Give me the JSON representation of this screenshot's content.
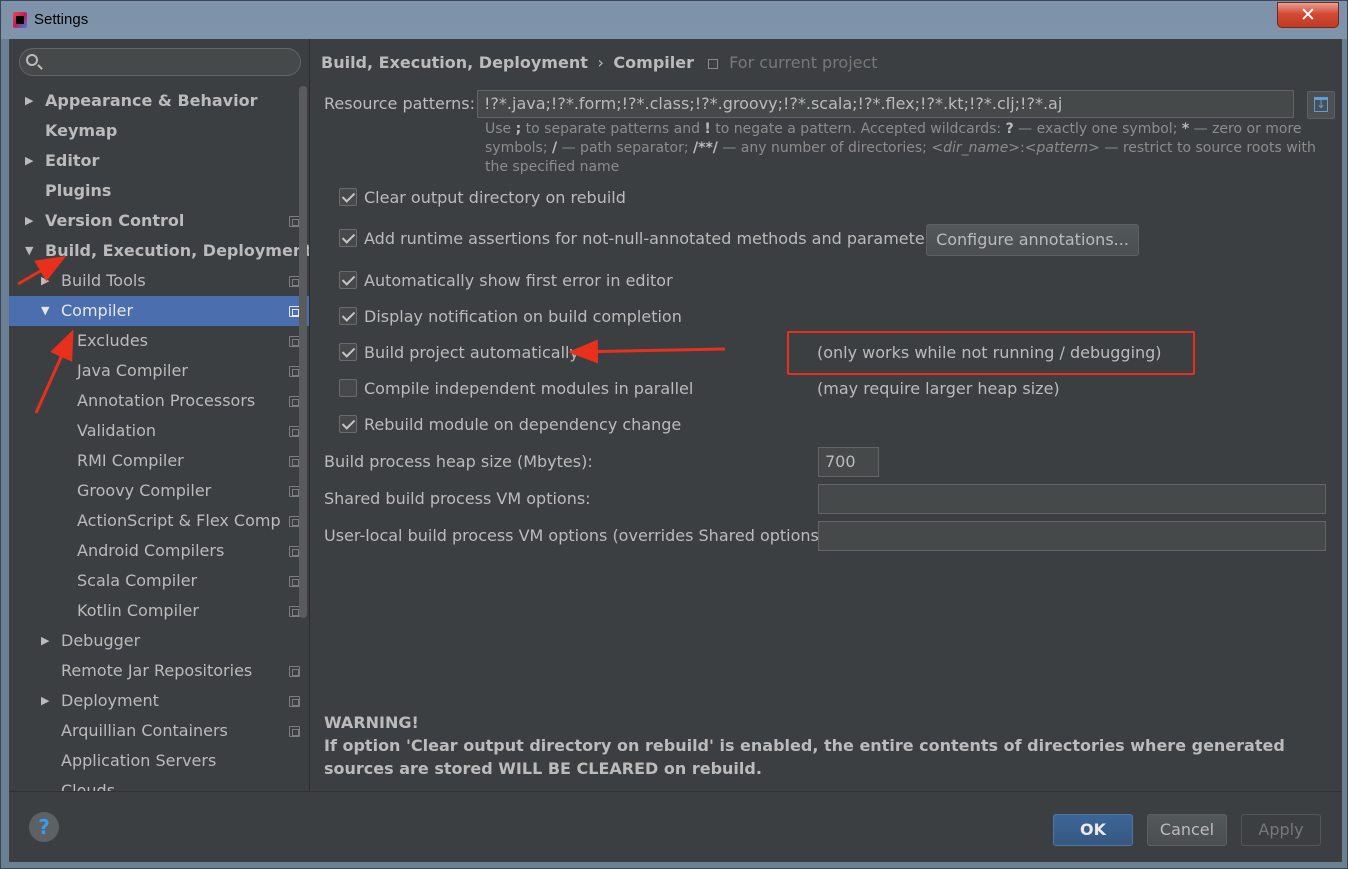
{
  "window": {
    "title": "Settings",
    "close_symbol": "✕"
  },
  "search": {
    "placeholder": ""
  },
  "sidebar": {
    "items": [
      {
        "label": "Appearance & Behavior",
        "arrow": "▶"
      },
      {
        "label": "Keymap"
      },
      {
        "label": "Editor",
        "arrow": "▶"
      },
      {
        "label": "Plugins"
      },
      {
        "label": "Version Control",
        "arrow": "▶"
      },
      {
        "label": "Build, Execution, Deployment",
        "arrow": "▼"
      },
      {
        "label": "Build Tools",
        "arrow": "▶"
      },
      {
        "label": "Compiler",
        "arrow": "▼"
      },
      {
        "label": "Excludes"
      },
      {
        "label": "Java Compiler"
      },
      {
        "label": "Annotation Processors"
      },
      {
        "label": "Validation"
      },
      {
        "label": "RMI Compiler"
      },
      {
        "label": "Groovy Compiler"
      },
      {
        "label": "ActionScript & Flex Comp"
      },
      {
        "label": "Android Compilers"
      },
      {
        "label": "Scala Compiler"
      },
      {
        "label": "Kotlin Compiler"
      },
      {
        "label": "Debugger",
        "arrow": "▶"
      },
      {
        "label": "Remote Jar Repositories"
      },
      {
        "label": "Deployment",
        "arrow": "▶"
      },
      {
        "label": "Arquillian Containers"
      },
      {
        "label": "Application Servers"
      },
      {
        "label": "Clouds"
      }
    ]
  },
  "breadcrumb": {
    "part1": "Build, Execution, Deployment",
    "separator": "›",
    "part2": "Compiler",
    "scope": "For current project"
  },
  "resource_patterns": {
    "label": "Resource patterns:",
    "value": "!?*.java;!?*.form;!?*.class;!?*.groovy;!?*.scala;!?*.flex;!?*.kt;!?*.clj;!?*.aj"
  },
  "hint": {
    "t1": "Use ",
    "b1": ";",
    "t2": " to separate patterns and ",
    "b2": "!",
    "t3": " to negate a pattern. Accepted wildcards: ",
    "b3": "?",
    "t4": " — exactly one symbol; ",
    "b4": "*",
    "t5": " — zero or more symbols; ",
    "b5": "/",
    "t6": " — path separator; ",
    "b6": "/**/",
    "t7": " — any number of directories; ",
    "i1": "<dir_name>",
    "t8": ":",
    "i2": "<pattern>",
    "t9": " — restrict to source roots with the specified name"
  },
  "options": {
    "clear_output": {
      "label": "Clear output directory on rebuild",
      "checked": true
    },
    "runtime_assertions": {
      "label": "Add runtime assertions for not-null-annotated methods and parameters",
      "checked": true
    },
    "configure_annotations": "Configure annotations...",
    "show_first_error": {
      "label": "Automatically show first error in editor",
      "checked": true
    },
    "display_notification": {
      "label": "Display notification on build completion",
      "checked": true
    },
    "build_automatically": {
      "label": "Build project automatically",
      "checked": true,
      "note": "(only works while not running / debugging)"
    },
    "compile_parallel": {
      "label": "Compile independent modules in parallel",
      "checked": false,
      "note": "(may require larger heap size)"
    },
    "rebuild_module": {
      "label": "Rebuild module on dependency change",
      "checked": true
    }
  },
  "heap": {
    "label": "Build process heap size (Mbytes):",
    "value": "700"
  },
  "shared_vm": {
    "label": "Shared build process VM options:",
    "value": ""
  },
  "user_vm": {
    "label": "User-local build process VM options (overrides Shared options):",
    "value": ""
  },
  "warning": {
    "title": "WARNING!",
    "text": "If option 'Clear output directory on rebuild' is enabled, the entire contents of directories where generated sources are stored WILL BE CLEARED on rebuild."
  },
  "footer": {
    "help": "?",
    "ok": "OK",
    "cancel": "Cancel",
    "apply": "Apply"
  },
  "colors": {
    "annotation_red": "#e8301d",
    "selection": "#4b6eaf",
    "background": "#3c3f41"
  }
}
